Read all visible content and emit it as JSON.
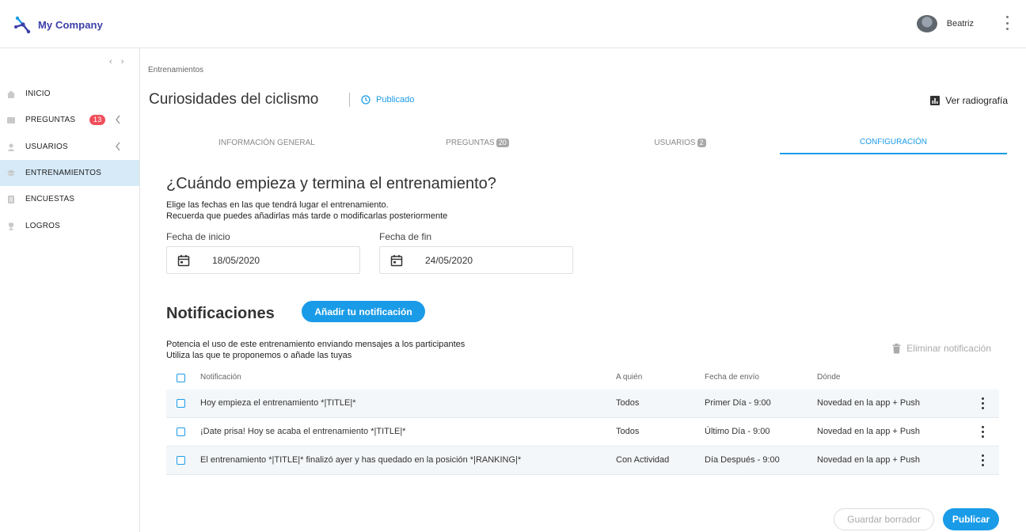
{
  "header": {
    "company": "My Company",
    "user_name": "Beatriz"
  },
  "colors": {
    "accent": "#1a9be8",
    "badge": "#ef4f5b",
    "active_nav_bg": "#d6eaf8",
    "brand": "#3b3fa8"
  },
  "sidebar": {
    "collapse_glyphs": "‹ ›",
    "items": [
      {
        "label": "INICIO",
        "icon": "home-icon"
      },
      {
        "label": "PREGUNTAS",
        "icon": "questions-icon",
        "badge": "13"
      },
      {
        "label": "USUARIOS",
        "icon": "user-icon"
      },
      {
        "label": "ENTRENAMIENTOS",
        "icon": "training-icon",
        "active": true
      },
      {
        "label": "ENCUESTAS",
        "icon": "survey-icon"
      },
      {
        "label": "LOGROS",
        "icon": "trophy-icon"
      }
    ]
  },
  "main": {
    "breadcrumb": "Entrenamientos",
    "title": "Curiosidades del ciclismo",
    "status": "Publicado",
    "xray": "Ver radiografía",
    "tabs": [
      {
        "label": "INFORMACIÓN GENERAL"
      },
      {
        "label": "PREGUNTAS",
        "count": "20"
      },
      {
        "label": "USUARIOS",
        "count": "2"
      },
      {
        "label": "CONFIGURACIÓN",
        "active": true
      }
    ],
    "schedule": {
      "heading": "¿Cuándo empieza y termina el entrenamiento?",
      "desc_line1": "Elige las fechas en las que tendrá lugar el entrenamiento.",
      "desc_line2": "Recuerda que puedes añadirlas más tarde o modificarlas posteriormente",
      "start_label": "Fecha de inicio",
      "start_value": "18/05/2020",
      "end_label": "Fecha de fin",
      "end_value": "24/05/2020"
    },
    "notifications": {
      "heading": "Notificaciones",
      "add_button": "Añadir tu notificación",
      "desc_line1": "Potencia el uso de este entrenamiento enviando mensajes a los participantes",
      "desc_line2": "Utiliza las que te proponemos o añade las tuyas",
      "delete_label": "Eliminar notificación",
      "columns": [
        "Notificación",
        "A quién",
        "Fecha de envío",
        "Dónde"
      ],
      "rows": [
        {
          "text": "Hoy empieza el entrenamiento *|TITLE|*",
          "who": "Todos",
          "when": "Primer Día - 9:00",
          "where": "Novedad en la app + Push"
        },
        {
          "text": "¡Date prisa! Hoy se acaba el entrenamiento *|TITLE|*",
          "who": "Todos",
          "when": "Último Día - 9:00",
          "where": "Novedad en la app + Push"
        },
        {
          "text": "El entrenamiento *|TITLE|* finalizó ayer y has quedado en la posición *|RANKING|*",
          "who": "Con Actividad",
          "when": "Día Después - 9:00",
          "where": "Novedad en la app + Push"
        }
      ]
    },
    "footer": {
      "draft": "Guardar borrador",
      "publish": "Publicar"
    }
  }
}
